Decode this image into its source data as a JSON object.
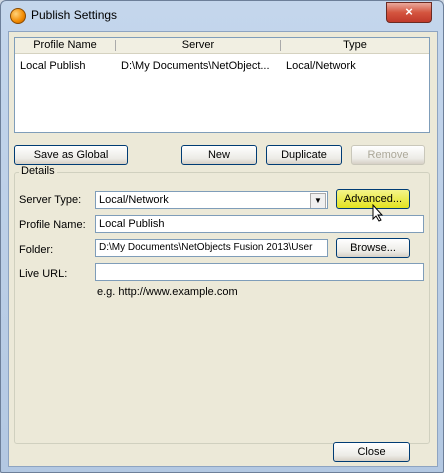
{
  "window": {
    "title": "Publish Settings",
    "close_symbol": "×"
  },
  "profiles_table": {
    "columns": [
      "Profile Name",
      "Server",
      "Type"
    ],
    "rows": [
      {
        "profile_name": "Local Publish",
        "server": "D:\\My Documents\\NetObject...",
        "type": "Local/Network"
      }
    ]
  },
  "buttons": {
    "save_as_global": "Save as Global",
    "new": "New",
    "duplicate": "Duplicate",
    "remove": "Remove",
    "advanced": "Advanced...",
    "browse": "Browse...",
    "close": "Close"
  },
  "details": {
    "group_label": "Details",
    "server_type_label": "Server Type:",
    "server_type_value": "Local/Network",
    "profile_name_label": "Profile Name:",
    "profile_name_value": "Local Publish",
    "folder_label": "Folder:",
    "folder_value": "D:\\My Documents\\NetObjects Fusion 2013\\User",
    "live_url_label": "Live URL:",
    "live_url_value": "",
    "live_url_hint": "e.g. http://www.example.com"
  }
}
